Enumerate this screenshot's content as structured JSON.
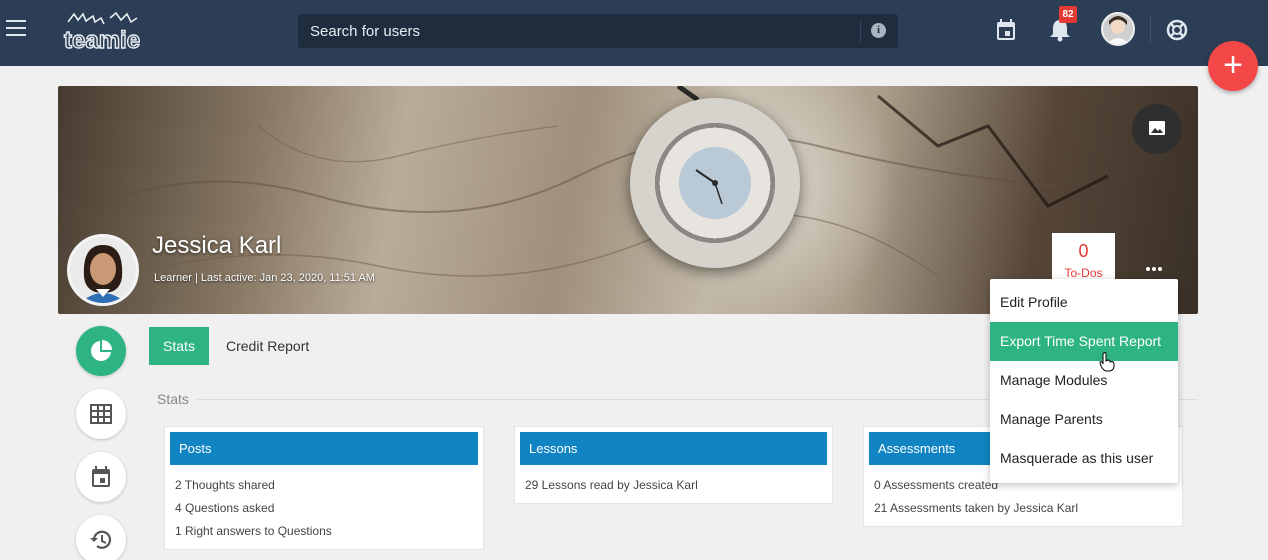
{
  "topbar": {
    "logo_text": "teamie",
    "search_placeholder": "Search for users",
    "notification_count": "82"
  },
  "profile": {
    "name": "Jessica Karl",
    "meta": "Learner | Last active: Jan 23, 2020, 11:51 AM",
    "todo_count": "0",
    "todo_label": "To-Dos"
  },
  "tabs": [
    {
      "label": "Stats",
      "active": true
    },
    {
      "label": "Credit Report",
      "active": false
    }
  ],
  "section_title": "Stats",
  "cards": [
    {
      "title": "Posts",
      "lines": [
        "2 Thoughts shared",
        "4 Questions asked",
        "1 Right answers to Questions"
      ]
    },
    {
      "title": "Lessons",
      "lines": [
        "29 Lessons read by Jessica Karl"
      ]
    },
    {
      "title": "Assessments",
      "lines": [
        "0 Assessments created",
        "21 Assessments taken by Jessica Karl"
      ]
    }
  ],
  "menu": {
    "items": [
      {
        "label": "Edit Profile",
        "highlighted": false
      },
      {
        "label": "Export Time Spent Report",
        "highlighted": true
      },
      {
        "label": "Manage Modules",
        "highlighted": false
      },
      {
        "label": "Manage Parents",
        "highlighted": false
      },
      {
        "label": "Masquerade as this user",
        "highlighted": false
      }
    ]
  },
  "colors": {
    "accent": "#2eb383",
    "header": "#2c3e55",
    "card_header": "#1184c3",
    "alert": "#e53935",
    "fab": "#f44848"
  }
}
